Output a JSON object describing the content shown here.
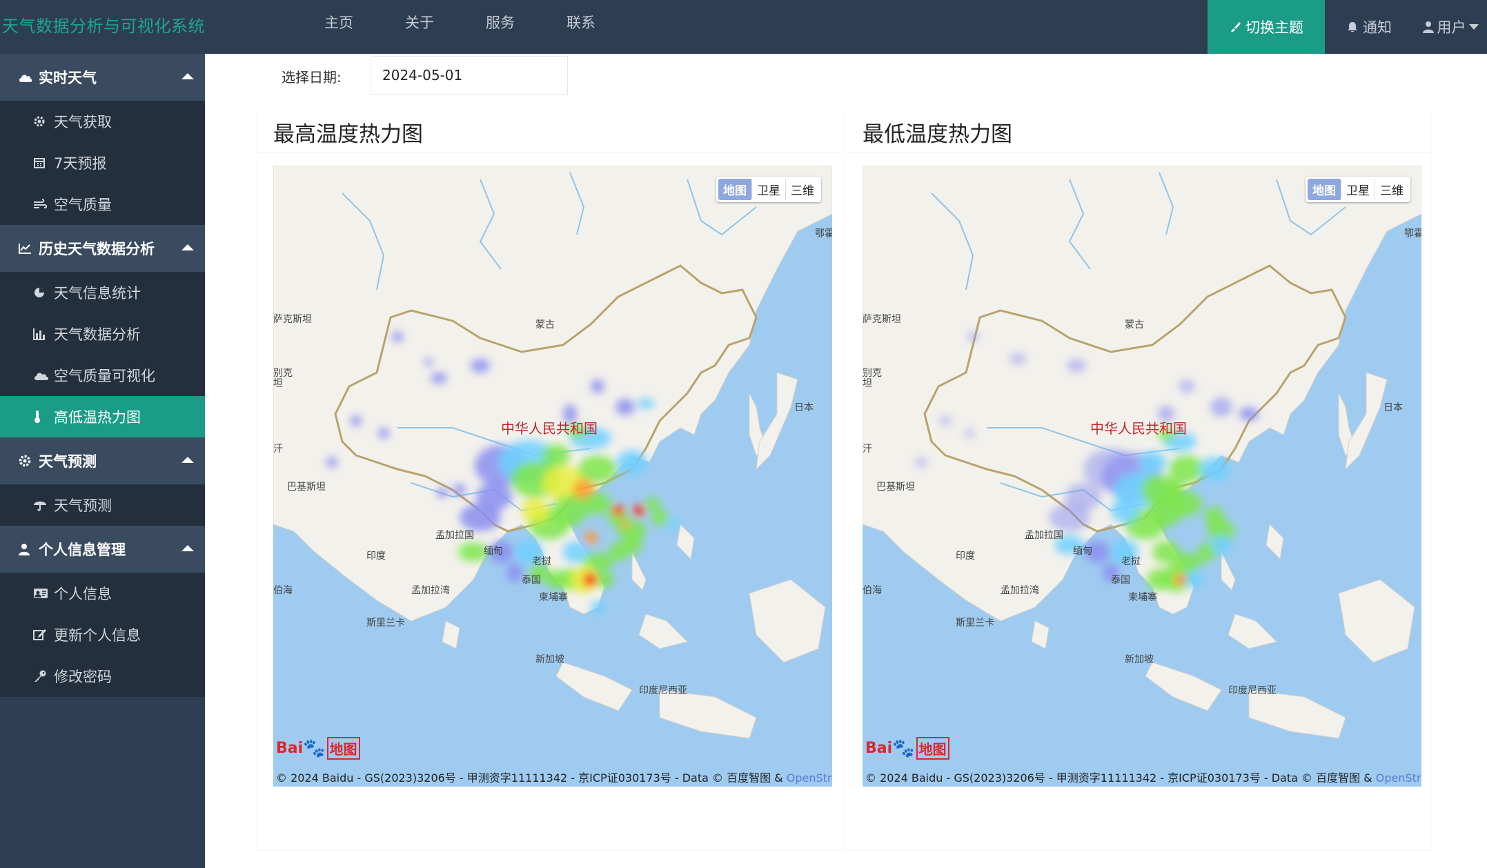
{
  "app": {
    "title": "天气数据分析与可视化系统"
  },
  "topnav": {
    "items": [
      "主页",
      "关于",
      "服务",
      "联系"
    ]
  },
  "topright": {
    "theme": "切换主题",
    "notify": "通知",
    "user": "用户"
  },
  "sidebar": {
    "groups": [
      {
        "label": "实时天气",
        "icon": "cloud-icon",
        "items": [
          {
            "label": "天气获取",
            "icon": "gear-icon"
          },
          {
            "label": "7天预报",
            "icon": "calendar-icon"
          },
          {
            "label": "空气质量",
            "icon": "wind-icon"
          }
        ]
      },
      {
        "label": "历史天气数据分析",
        "icon": "line-chart-icon",
        "items": [
          {
            "label": "天气信息统计",
            "icon": "pie-chart-icon"
          },
          {
            "label": "天气数据分析",
            "icon": "bar-chart-icon"
          },
          {
            "label": "空气质量可视化",
            "icon": "cloud-icon"
          },
          {
            "label": "高低温热力图",
            "icon": "thermometer-icon",
            "active": true
          }
        ]
      },
      {
        "label": "天气预测",
        "icon": "gear-icon",
        "items": [
          {
            "label": "天气预测",
            "icon": "umbrella-icon"
          }
        ]
      },
      {
        "label": "个人信息管理",
        "icon": "user-icon",
        "items": [
          {
            "label": "个人信息",
            "icon": "id-card-icon"
          },
          {
            "label": "更新个人信息",
            "icon": "edit-icon"
          },
          {
            "label": "修改密码",
            "icon": "key-icon"
          }
        ]
      }
    ]
  },
  "main": {
    "date_label": "选择日期:",
    "date_value": "2024-05-01",
    "panels": [
      {
        "title": "最高温度热力图"
      },
      {
        "title": "最低温度热力图"
      }
    ]
  },
  "map": {
    "types": [
      "地图",
      "卫星",
      "三维"
    ],
    "country": "中华人民共和国",
    "labels": [
      "蒙古",
      "萨克斯坦",
      "别克",
      "坦",
      "汗",
      "巴基斯坦",
      "孟加拉国",
      "印度",
      "缅甸",
      "老挝",
      "泰国",
      "柬埔寨",
      "孟加拉湾",
      "伯海",
      "斯里兰卡",
      "新加坡",
      "印度尼西亚",
      "日本",
      "鄂霍"
    ],
    "baidu_logo": "Bai",
    "baidu_logo_suffix": "地图",
    "copyright": "© 2024 Baidu - GS(2023)3206号 - 甲测资字11111342 - 京ICP证030173号 - Data © 百度智图 & ",
    "osm": "OpenStreetMap"
  },
  "colors": {
    "topbar": "#2e3e52",
    "accent": "#1b9c87",
    "sidebar_item": "#242f3d",
    "sidebar_head": "#3a4b60"
  }
}
